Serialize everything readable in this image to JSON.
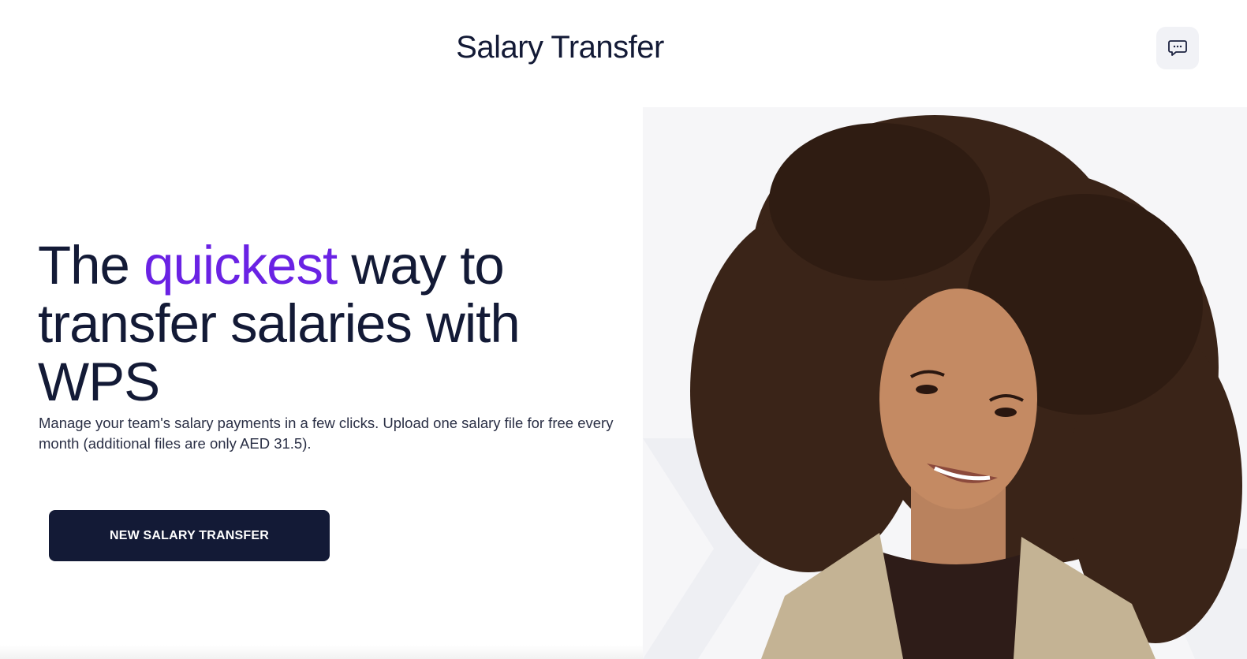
{
  "header": {
    "title": "Salary Transfer",
    "chat_icon": "chat-bubble-icon"
  },
  "hero": {
    "title_prefix": "The ",
    "title_accent": "quickest",
    "title_suffix": " way to transfer salaries with WPS",
    "description": "Manage your team's salary payments in a few clicks. Upload one salary file for free every month (additional files are only AED 31.5).",
    "cta_label": "NEW SALARY TRANSFER",
    "image_alt": "smiling woman with curly hair"
  },
  "colors": {
    "primary": "#131a36",
    "accent": "#6a22e4",
    "chat_button_bg": "#f1f2f6"
  }
}
